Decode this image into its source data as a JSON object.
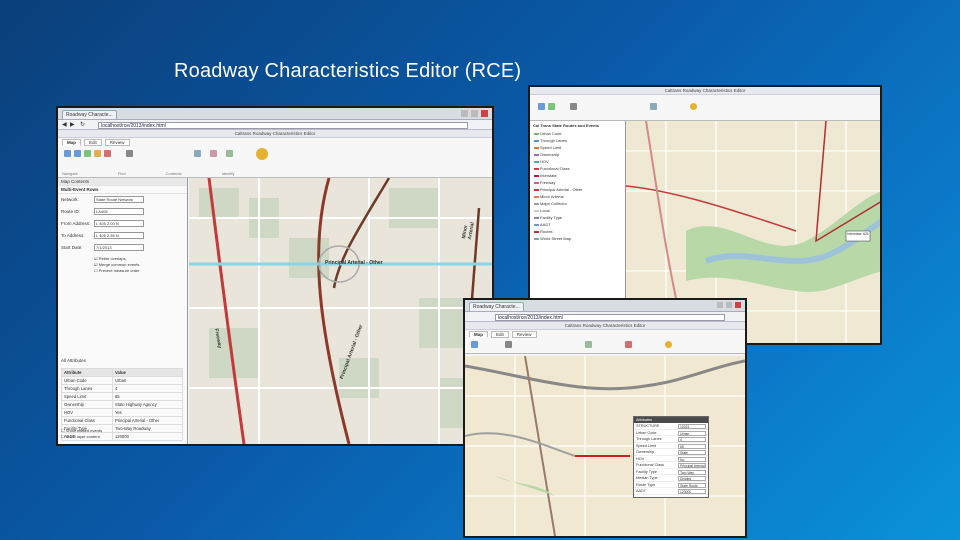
{
  "slide": {
    "title": "Roadway Characteristics Editor (RCE)"
  },
  "screenshot1": {
    "browser_tab": "Roadway Characte...",
    "url": "localhost/rce/2013/index.html",
    "app_title": "Caltrans Roadway Characteristics Editor",
    "ribbon_tabs": [
      "Map",
      "Edit",
      "Review"
    ],
    "ribbon_groups": [
      "Navigate",
      "Find",
      "Contents",
      "Identify"
    ],
    "layer_header": "Map Contents",
    "panel_title": "Multi-Event Rows",
    "fields": [
      {
        "label": "Network:",
        "value": "State Route Network"
      },
      {
        "label": "Route ID:",
        "value": "LA405"
      },
      {
        "label": "From Address:",
        "value": "L 405 2.00 N"
      },
      {
        "label": "To Address:",
        "value": "L 405 2.35 N"
      },
      {
        "label": "Start Date:",
        "value": "7/1/2013"
      }
    ],
    "checkboxes": [
      "Retire overlaps",
      "Merge common events",
      "Prevent measure order"
    ],
    "attributes_header": "All Attributes",
    "attr_columns": [
      "Attribute",
      "Value"
    ],
    "attr_rows": [
      [
        "Urban Code",
        "Urban"
      ],
      [
        "Through Lanes",
        "4"
      ],
      [
        "Speed Limit",
        "65"
      ],
      [
        "Ownership",
        "State Highway Agency"
      ],
      [
        "HOV",
        "Yes"
      ],
      [
        "Functional Class",
        "Principal Arterial - Other"
      ],
      [
        "Facility Type",
        "Two-Way Roadway"
      ],
      [
        "AADT",
        "120000"
      ]
    ],
    "bottom_checks": [
      "Show related events",
      "Show layer content"
    ],
    "map_labels": [
      "Principal Arterial - Other",
      "Minor Arterial",
      "Principal Arterial - Other",
      "Freeway"
    ]
  },
  "screenshot2": {
    "window_title": "Caltrans Roadway Characteristics Editor",
    "toc_title": "Cal Trans State Routes and Events",
    "toc_items": [
      {
        "label": "Urban Code",
        "color": "#7fb46a"
      },
      {
        "label": "Through Lanes",
        "color": "#5a8fd0"
      },
      {
        "label": "Speed Limit",
        "color": "#d07a3a"
      },
      {
        "label": "Ownership",
        "color": "#9b6cc4"
      },
      {
        "label": "HOV",
        "color": "#4fa6a6"
      },
      {
        "label": "Functional Class",
        "color": "#c84040"
      },
      {
        "label": "Interstate",
        "color": "#b0204a"
      },
      {
        "label": "Freeway",
        "color": "#d06080"
      },
      {
        "label": "Principal Arterial - Other",
        "color": "#c03a3a"
      },
      {
        "label": "Minor Arterial",
        "color": "#e07a5a"
      },
      {
        "label": "Major Collector",
        "color": "#a0a0a0"
      },
      {
        "label": "Local",
        "color": "#cccccc"
      },
      {
        "label": "Facility Type",
        "color": "#8888aa"
      },
      {
        "label": "AADT",
        "color": "#7799bb"
      },
      {
        "label": "Routes",
        "color": "#c03030"
      },
      {
        "label": "World Street Map",
        "color": "#999999"
      }
    ],
    "map_label": "Interstate 405"
  },
  "screenshot3": {
    "browser_tab": "Roadway Characte...",
    "url": "localhost/rce/2013/index.html",
    "app_title": "Caltrans Roadway Characteristics Editor",
    "ribbon_tabs": [
      "Map",
      "Edit",
      "Review"
    ],
    "editor_title": "Attributes",
    "editor_rows": [
      [
        "STRUCTURE",
        "10021"
      ],
      [
        "Urban Code",
        "Urban"
      ],
      [
        "Through Lanes",
        "4"
      ],
      [
        "Speed Limit",
        "65"
      ],
      [
        "Ownership",
        "State"
      ],
      [
        "HOV",
        "No"
      ],
      [
        "Functional Class",
        "Principal Arterial"
      ],
      [
        "Facility Type",
        "Two-Way"
      ],
      [
        "Median Type",
        "Divided"
      ],
      [
        "Route Type",
        "State Route"
      ],
      [
        "AADT",
        "120000"
      ]
    ]
  }
}
